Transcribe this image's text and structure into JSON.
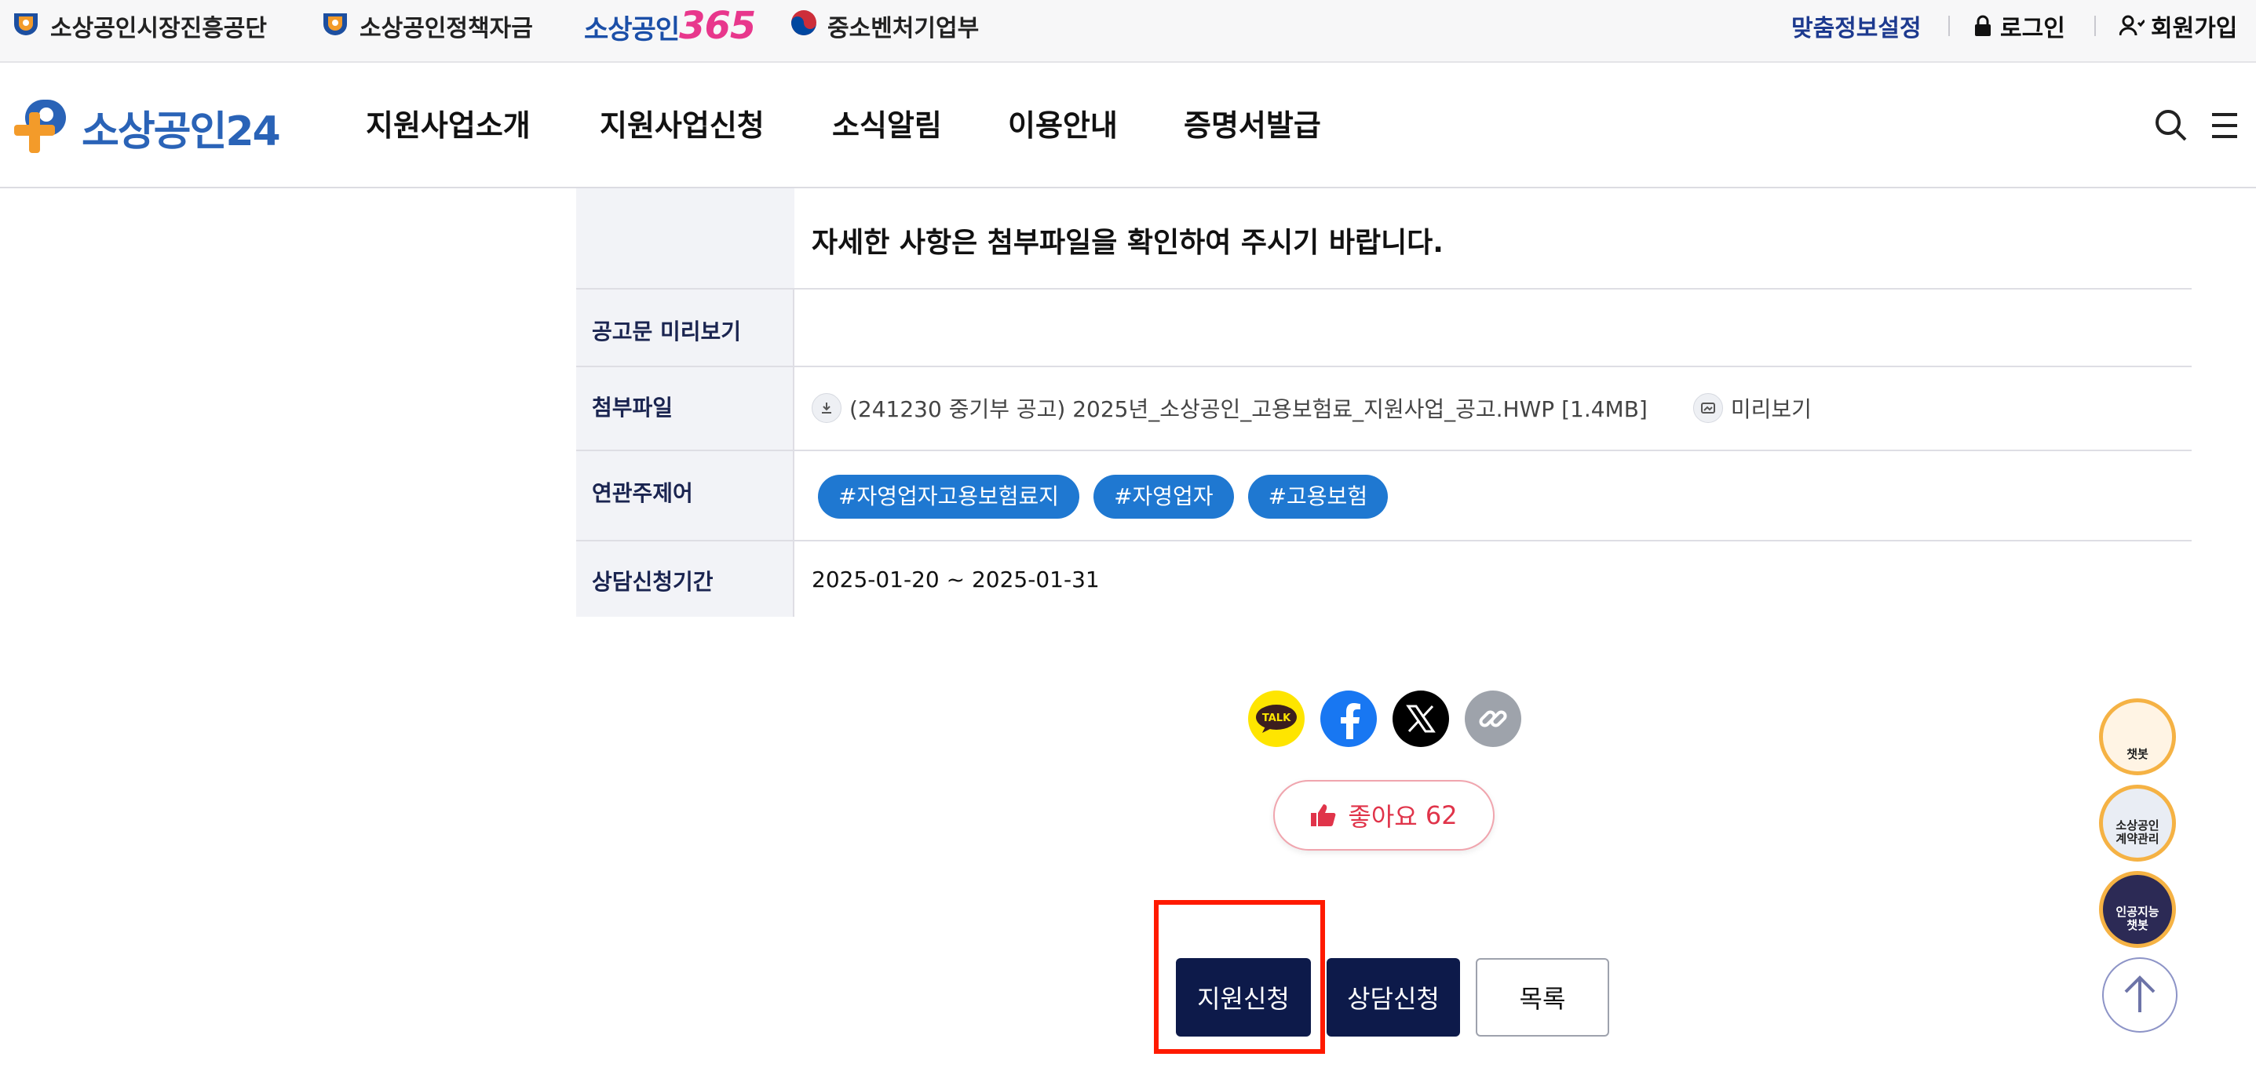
{
  "topbar": {
    "links": [
      {
        "label": "소상공인시장진흥공단",
        "icon": "semas-logo-icon"
      },
      {
        "label": "소상공인정책자금",
        "icon": "semas-logo-icon"
      },
      {
        "brand_text": "소상공인",
        "brand_num": "365"
      },
      {
        "label": "중소벤처기업부",
        "icon": "korea-taegeuk-icon"
      }
    ],
    "custom_info_label": "맞춤정보설정",
    "login_label": "로그인",
    "signup_label": "회원가입"
  },
  "nav": {
    "logo_text": "소상공인24",
    "items": [
      "지원사업소개",
      "지원사업신청",
      "소식알림",
      "이용안내",
      "증명서발급"
    ]
  },
  "detail": {
    "notice_text": "자세한 사항은 첨부파일을 확인하여 주시기 바랍니다.",
    "rows": [
      {
        "label": "공고문 미리보기",
        "value": ""
      },
      {
        "label": "첨부파일",
        "file_name": "(241230 중기부 공고) 2025년_소상공인_고용보험료_지원사업_공고.HWP [1.4MB]",
        "preview_label": "미리보기"
      },
      {
        "label": "연관주제어",
        "tags": [
          "#자영업자고용보험료지",
          "#자영업자",
          "#고용보험"
        ]
      },
      {
        "label": "상담신청기간",
        "value": "2025-01-20 ~ 2025-01-31"
      }
    ]
  },
  "share": {
    "icons": [
      "kakaotalk-icon",
      "facebook-icon",
      "x-twitter-icon",
      "link-copy-icon"
    ],
    "kakao_text": "TALK"
  },
  "like": {
    "label": "좋아요",
    "count": "62"
  },
  "actions": {
    "apply_label": "지원신청",
    "consult_label": "상담신청",
    "list_label": "목록"
  },
  "floating": {
    "chatbot_label": "챗봇",
    "contract_label": "소상공인 계약관리",
    "ai_chatbot_label": "인공지능 챗봇"
  },
  "colors": {
    "navy": "#0d1a4a",
    "tag_blue": "#1f78d1",
    "highlight_red": "#ff1a00",
    "like_red": "#e0344a",
    "brand_blue": "#2a63b7",
    "brand_orange": "#f39b2a"
  }
}
